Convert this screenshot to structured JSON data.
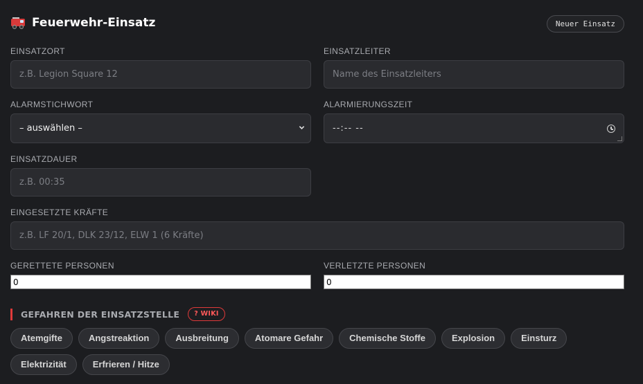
{
  "header": {
    "title": "Feuerwehr-Einsatz",
    "icon": "fire-truck-icon",
    "new_button": "Neuer Einsatz"
  },
  "form": {
    "einsatzort": {
      "label": "EINSATZORT",
      "placeholder": "z.B. Legion Square 12",
      "value": ""
    },
    "einsatzleiter": {
      "label": "EINSATZLEITER",
      "placeholder": "Name des Einsatzleiters",
      "value": ""
    },
    "alarmstichwort": {
      "label": "ALARMSTICHWORT",
      "selected": "– auswählen –"
    },
    "alarmierungszeit": {
      "label": "ALARMIERUNGSZEIT",
      "value": "--:-- --"
    },
    "einsatzdauer": {
      "label": "EINSATZDAUER",
      "placeholder": "z.B. 00:35",
      "value": ""
    },
    "kraefte": {
      "label": "EINGESETZTE KRÄFTE",
      "placeholder": "z.B. LF 20/1, DLK 23/12, ELW 1 (6 Kräfte)",
      "value": ""
    },
    "gerettete": {
      "label": "GERETTETE PERSONEN",
      "value": "0"
    },
    "verletzte": {
      "label": "VERLETZTE PERSONEN",
      "value": "0"
    }
  },
  "hazards": {
    "title": "GEFAHREN DER EINSATZSTELLE",
    "wiki_label": "? WIKI",
    "accent": "#e03a3a",
    "items": [
      "Atemgifte",
      "Angstreaktion",
      "Ausbreitung",
      "Atomare Gefahr",
      "Chemische Stoffe",
      "Explosion",
      "Einsturz",
      "Elektrizität",
      "Erfrieren / Hitze"
    ]
  }
}
